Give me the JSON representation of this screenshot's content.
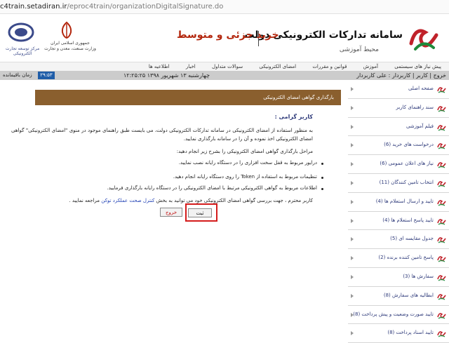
{
  "browser": {
    "url_host": "c4train.setadiran.ir",
    "url_path": "/eproc4train/organizationDigitalSignature.do"
  },
  "header": {
    "title": "سامانه تدارکات الکترونیکی دولت",
    "tagline": "خرید جزئی و متوسط",
    "subtitle": "محیط آموزشی",
    "emblem_caption_1": "جمهوری اسلامی ایران",
    "emblem_caption_2": "وزارت صنعت، معدن و تجارت",
    "logo2_caption": "مرکز توسعه تجارت الکترونیکی",
    "brand_color": "#b3260d"
  },
  "menu": [
    "پیش نیاز های سیستمی",
    "آموزش",
    "قوانین و مقررات",
    "امضای الکترونیکی",
    "سوالات متداول",
    "اخبار",
    "اطلاعیه ها"
  ],
  "status": {
    "user": "خروج | کاربر | کاربردار : علی کاربردار",
    "date": "چهارشنبه ۱۳ شهریور ۱۳۹۸   ۱۲:۲۵:۲۵",
    "timer_label": "زمان باقیمانده",
    "timer": "۲۹:۵۳"
  },
  "sidebar": {
    "items": [
      {
        "label": "صفحه اصلی"
      },
      {
        "label": "سند راهنمای کاربر"
      },
      {
        "label": "فیلم آموزشی"
      },
      {
        "label": "درخواست های خرید (6)"
      },
      {
        "label": "نیاز های اعلان عمومی (6)"
      },
      {
        "label": "انتخاب تامین کنندگان (11)"
      },
      {
        "label": "تایید و ارسال استعلام ها (4)"
      },
      {
        "label": "تایید پاسخ استعلام ها (4)"
      },
      {
        "label": "جدول مقایسه ای (5)"
      },
      {
        "label": "پاسخ تامین کننده برنده (2)"
      },
      {
        "label": "سفارش ها (3)"
      },
      {
        "label": "ابطالیه های سفارش (8)"
      },
      {
        "label": "تایید صورت وضعیت و پیش پرداخت (8)"
      },
      {
        "label": "تایید اسناد پرداخت (8)"
      }
    ]
  },
  "main": {
    "title": "بارگذاری گواهی امضای الکترونیکی",
    "section_head": "کاربر گرامی :",
    "para1": "به منظور استفاده از امضای الکترونیکی در سامانه تدارکات الکترونیکی دولت، می بایست طبق راهنمای موجود در منوی \"امضای الکترونیکی\" گواهی امضای الکترونیکی اخذ نموده و آن را در سامانه بارگذاری نمایید.",
    "para2": "مراحل بارگذاری گواهی امضای الکترونیکی را بشرح زیر انجام دهید:",
    "bullets": [
      "درایور مربوط به قفل سخت افزاری را در دستگاه رایانه نصب نمایید.",
      "تنظیمات مربوط به استفاده از Token را روی دستگاه رایانه انجام دهید.",
      "اطلاعات مربوط به گواهی الکترونیکی مرتبط با امضای الکترونیکی را در دستگاه رایانه بارگذاری فرمایید."
    ],
    "para3_pre": "کاربر محترم ، جهت بررسی گواهی امضای الکترونیکی خود می توانید به بخش",
    "para3_link": "کنترل صحت عملکرد توکن",
    "para3_post": "مراجعه نمایید .",
    "exit_label": "خروج",
    "confirm_label": "ثبت"
  }
}
